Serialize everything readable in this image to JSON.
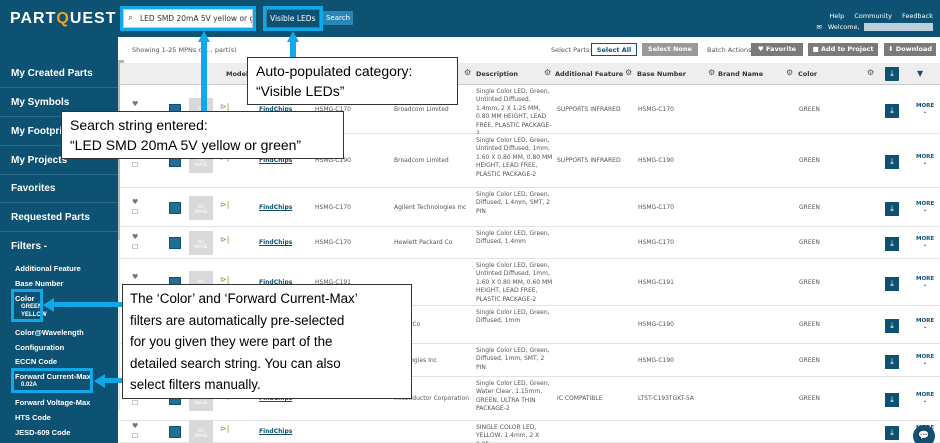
{
  "header": {
    "logo_main": "PARTQUEST",
    "search_value": "LED SMD 20mA 5V yellow or green",
    "category_value": "Visible LEDs",
    "search_button": "Search",
    "links": [
      "Help",
      "Community",
      "Feedback"
    ],
    "welcome": "Welcome,",
    "welcome_name": "redacted user name"
  },
  "sidebar": {
    "nav": [
      "My Created Parts",
      "My Symbols",
      "My Footprints",
      "My Projects",
      "Favorites",
      "Requested Parts"
    ],
    "filters_title": "Filters -",
    "filters": [
      {
        "label": "Additional Feature",
        "values": []
      },
      {
        "label": "Base Number",
        "values": []
      },
      {
        "label": "Color",
        "values": [
          "GREEN",
          "YELLOW"
        ]
      },
      {
        "label": "Color@Wavelength",
        "values": []
      },
      {
        "label": "Configuration",
        "values": []
      },
      {
        "label": "ECCN Code",
        "values": []
      },
      {
        "label": "Forward Current-Max",
        "values": [
          "0.02A"
        ]
      },
      {
        "label": "Forward Voltage-Max",
        "values": []
      },
      {
        "label": "HTS Code",
        "values": []
      },
      {
        "label": "JESD-609 Code",
        "values": []
      }
    ]
  },
  "toolbar": {
    "results": "Showing 1-25 MPNs of ... part(s)",
    "select_parts": "Select Parts:",
    "select_all": "Select All",
    "select_none": "Select None",
    "batch_actions": "Batch Actions:",
    "favorite": "♥ Favorite",
    "add_to_project": "■ Add to Project",
    "download": "⬇ Download"
  },
  "table": {
    "headers": {
      "model": "Model",
      "description": "Description",
      "additional_feature": "Additional Feature",
      "base_number": "Base Number",
      "brand_name": "Brand Name",
      "color": "Color"
    },
    "findchips": "FindChips",
    "more": "MORE",
    "rows": [
      {
        "part": "HSMG-C170",
        "mfr": "Broadcom Limited",
        "desc": "Single Color LED, Green, Untinted Diffused, 1.4mm, 2 X 1.25 MM, 0.80 MM HEIGHT, LEAD FREE, PLASTIC PACKAGE-2",
        "feature": "SUPPORTS INFRARED",
        "base": "HSMG-C170",
        "color": "GREEN"
      },
      {
        "part": "HSMG-C190",
        "mfr": "Broadcom Limited",
        "desc": "Single Color LED, Green, Untinted Diffused, 1mm, 1.60 X 0.80 MM, 0.80 MM HEIGHT, LEAD FREE, PLASTIC PACKAGE-2",
        "feature": "SUPPORTS INFRARED",
        "base": "HSMG-C190",
        "color": "GREEN"
      },
      {
        "part": "HSMG-C170",
        "mfr": "Agilent Technologies Inc",
        "desc": "Single Color LED, Green, Diffused, 1.4mm, SMT, 2 PIN",
        "feature": "",
        "base": "HSMG-C170",
        "color": "GREEN"
      },
      {
        "part": "HSMG-C170",
        "mfr": "Hewlett Packard Co",
        "desc": "Single Color LED, Green, Diffused, 1.4mm",
        "feature": "",
        "base": "HSMG-C170",
        "color": "GREEN"
      },
      {
        "part": "HSMG-C191",
        "mfr": "",
        "desc": "Single Color LED, Green, Untinted Diffused, 1mm, 1.60 X 0.80 MM, 0.60 MM HEIGHT, LEAD FREE, PLASTIC PACKAGE-2",
        "feature": "",
        "base": "HSMG-C191",
        "color": "GREEN"
      },
      {
        "part": "",
        "mfr": "ckard Co",
        "desc": "Single Color LED, Green, Diffused, 1mm",
        "feature": "",
        "base": "HSMG-C190",
        "color": "GREEN"
      },
      {
        "part": "",
        "mfr": "chnologies Inc",
        "desc": "Single Color LED, Green, Diffused, 1mm, SMT, 2 PIN",
        "feature": "",
        "base": "HSMG-C190",
        "color": "GREEN"
      },
      {
        "part": "",
        "mfr": "miconductor Corporation",
        "desc": "Single Color LED, Green, Water Clear, 1.15mm, GREEN, ULTRA THIN PACKAGE-2",
        "feature": "IC COMPATIBLE",
        "base": "LTST-C193TGKT-5A",
        "color": "GREEN"
      },
      {
        "part": "",
        "mfr": "",
        "desc": "SINGLE COLOR LED, YELLOW, 1.4mm, 2 X 1.25",
        "feature": "",
        "base": "",
        "color": ""
      }
    ]
  },
  "callouts": {
    "category": [
      "Auto-populated category:",
      "“Visible LEDs”"
    ],
    "search": [
      "Search string entered:",
      "“LED SMD 20mA 5V yellow or green”"
    ],
    "filters": [
      "The ‘Color’ and ‘Forward Current-Max’",
      "filters are automatically pre-selected",
      "for you given they were part of the",
      "detailed search string. You can also",
      "select filters manually."
    ]
  },
  "colors": {
    "brand": "#0e5273",
    "accent": "#f4a21d",
    "highlight": "#10a8e6"
  }
}
